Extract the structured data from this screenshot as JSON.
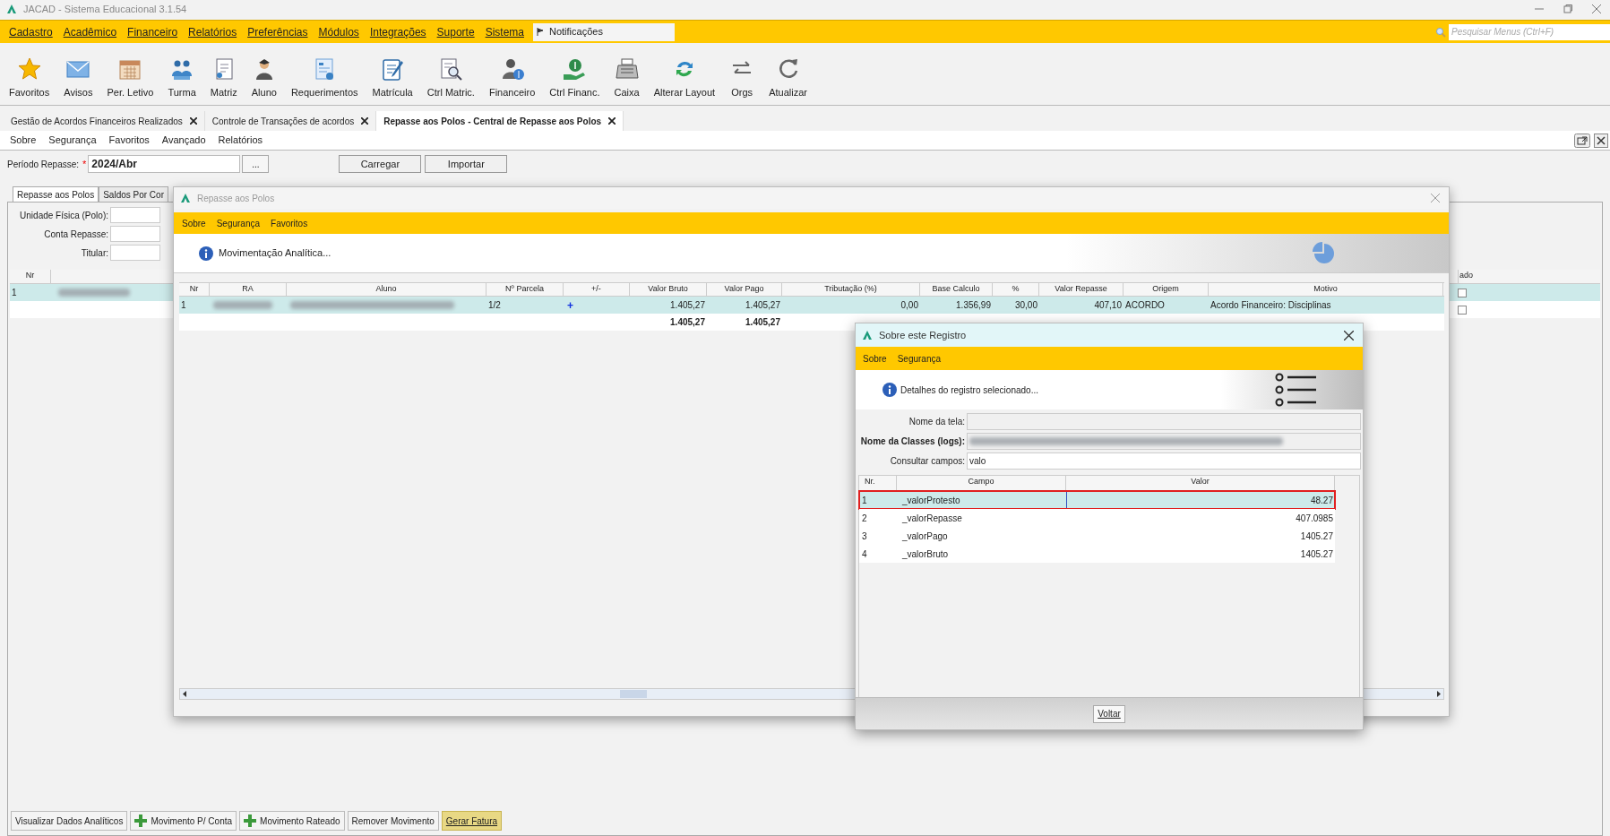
{
  "window": {
    "title": "JACAD - Sistema Educacional 3.1.54"
  },
  "menu": [
    "Cadastro",
    "Acadêmico",
    "Financeiro",
    "Relatórios",
    "Preferências",
    "Módulos",
    "Integrações",
    "Suporte",
    "Sistema"
  ],
  "notifications": "Notificações",
  "menu_search": {
    "placeholder": "Pesquisar Menus (Ctrl+F)"
  },
  "toolbar": [
    "Favoritos",
    "Avisos",
    "Per. Letivo",
    "Turma",
    "Matriz",
    "Aluno",
    "Requerimentos",
    "Matrícula",
    "Ctrl Matric.",
    "Financeiro",
    "Ctrl Financ.",
    "Caixa",
    "Alterar Layout",
    "Orgs",
    "Atualizar"
  ],
  "doc_tabs": [
    {
      "label": "Gestão de Acordos Financeiros Realizados",
      "selected": false
    },
    {
      "label": "Controle de Transações de acordos",
      "selected": false
    },
    {
      "label": "Repasse aos Polos - Central de Repasse aos Polos",
      "selected": true
    }
  ],
  "submenu": [
    "Sobre",
    "Segurança",
    "Favoritos",
    "Avançado",
    "Relatórios"
  ],
  "period": {
    "label": "Período Repasse:",
    "required_mark": "*",
    "value": "2024/Abr",
    "browse": "...",
    "buttons": [
      "Carregar",
      "Importar"
    ]
  },
  "panel_tabs": [
    {
      "label": "Repasse aos Polos",
      "selected": true
    },
    {
      "label": "Saldos Por Cor",
      "selected": false
    }
  ],
  "filters": [
    "Unidade Física (Polo):",
    "Conta Repasse:",
    "Titular:"
  ],
  "back_table": {
    "columns": [
      "Nr",
      "ado"
    ],
    "rows": [
      {
        "nr": "1",
        "selected": true,
        "checked": false
      },
      {
        "nr": "",
        "selected": false,
        "checked": false
      }
    ]
  },
  "bottom_buttons": [
    {
      "label": "Visualizar Dados Analíticos",
      "kind": "plain"
    },
    {
      "label": "Movimento P/ Conta",
      "kind": "add"
    },
    {
      "label": "Movimento Rateado",
      "kind": "add"
    },
    {
      "label": "Remover Movimento",
      "kind": "plain"
    },
    {
      "label": "Gerar Fatura",
      "kind": "highlight"
    }
  ],
  "dialog": {
    "title": "Repasse aos Polos",
    "menu": [
      "Sobre",
      "Segurança",
      "Favoritos"
    ],
    "header": "Movimentação Analítica...",
    "table": {
      "columns": [
        "Nr",
        "RA",
        "Aluno",
        "Nº Parcela",
        "+/-",
        "Valor Bruto",
        "Valor Pago",
        "Tributação (%)",
        "Base Calculo",
        "%",
        "Valor Repasse",
        "Origem",
        "Motivo"
      ],
      "rows": [
        {
          "selected": true,
          "cells": [
            {
              "kind": "text",
              "text": "1"
            },
            {
              "kind": "redacted"
            },
            {
              "kind": "redacted"
            },
            {
              "kind": "text",
              "text": "1/2"
            },
            {
              "kind": "sign",
              "text": "+"
            },
            {
              "kind": "number",
              "text": "1.405,27"
            },
            {
              "kind": "number",
              "text": "1.405,27"
            },
            {
              "kind": "number",
              "text": "0,00"
            },
            {
              "kind": "number",
              "text": "1.356,99"
            },
            {
              "kind": "number",
              "text": "30,00"
            },
            {
              "kind": "number",
              "text": "407,10"
            },
            {
              "kind": "text",
              "text": "ACORDO"
            },
            {
              "kind": "text",
              "text": "Acordo Financeiro: Disciplinas"
            }
          ]
        }
      ],
      "totals": {
        "valor_bruto": "1.405,27",
        "valor_pago": "1.405,27"
      }
    }
  },
  "record_dialog": {
    "title": "Sobre este Registro",
    "menu": [
      "Sobre",
      "Segurança"
    ],
    "header": "Detalhes do registro selecionado...",
    "fields": [
      {
        "label": "Nome da tela:",
        "kind": "empty",
        "bold": false
      },
      {
        "label": "Nome da Classes (logs):",
        "kind": "redacted",
        "bold": true
      },
      {
        "label": "Consultar campos:",
        "kind": "text",
        "value": "valo",
        "bold": false
      }
    ],
    "table": {
      "columns": [
        "Nr.",
        "Campo",
        "Valor"
      ],
      "rows": [
        {
          "nr": "1",
          "campo": "_valorProtesto",
          "valor": "48.27",
          "selected": true,
          "outlined": true
        },
        {
          "nr": "2",
          "campo": "_valorRepasse",
          "valor": "407.0985",
          "selected": false,
          "outlined": false
        },
        {
          "nr": "3",
          "campo": "_valorPago",
          "valor": "1405.27",
          "selected": false,
          "outlined": false
        },
        {
          "nr": "4",
          "campo": "_valorBruto",
          "valor": "1405.27",
          "selected": false,
          "outlined": false
        }
      ]
    },
    "button": "Voltar"
  }
}
